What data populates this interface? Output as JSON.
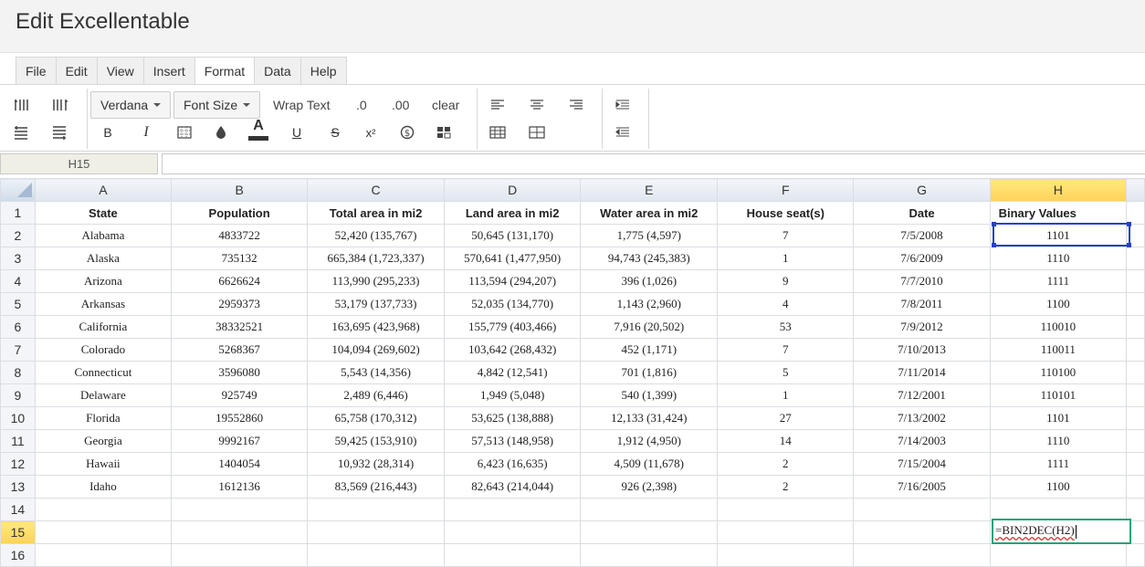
{
  "app": {
    "title": "Edit Excellentable"
  },
  "menu": [
    "File",
    "Edit",
    "View",
    "Insert",
    "Format",
    "Data",
    "Help"
  ],
  "menu_active": "Format",
  "toolbar": {
    "font_family": "Verdana",
    "font_size": "Font Size",
    "wrap_text": "Wrap Text",
    "decrease_decimal": ".0",
    "increase_decimal": ".00",
    "clear": "clear",
    "bold": "B",
    "italic": "I",
    "underline": "U",
    "strikethrough": "S",
    "text_color": "A",
    "superscript": "x²"
  },
  "name_box": "H15",
  "formula_bar": "",
  "columns": [
    "A",
    "B",
    "C",
    "D",
    "E",
    "F",
    "G",
    "H"
  ],
  "selected_column": "H",
  "selected_row": "15",
  "rows": [
    {
      "n": "1",
      "cells": [
        "State",
        "Population",
        "Total area in mi2",
        "Land area in mi2",
        "Water area in mi2",
        "House seat(s)",
        "Date",
        "Binary Values"
      ]
    },
    {
      "n": "2",
      "cells": [
        "Alabama",
        "4833722",
        "52,420 (135,767)",
        "50,645 (131,170)",
        "1,775 (4,597)",
        "7",
        "7/5/2008",
        "1101"
      ]
    },
    {
      "n": "3",
      "cells": [
        "Alaska",
        "735132",
        "665,384 (1,723,337)",
        "570,641 (1,477,950)",
        "94,743 (245,383)",
        "1",
        "7/6/2009",
        "1110"
      ]
    },
    {
      "n": "4",
      "cells": [
        "Arizona",
        "6626624",
        "113,990 (295,233)",
        "113,594 (294,207)",
        "396 (1,026)",
        "9",
        "7/7/2010",
        "1111"
      ]
    },
    {
      "n": "5",
      "cells": [
        "Arkansas",
        "2959373",
        "53,179 (137,733)",
        "52,035 (134,770)",
        "1,143 (2,960)",
        "4",
        "7/8/2011",
        "1100"
      ]
    },
    {
      "n": "6",
      "cells": [
        "California",
        "38332521",
        "163,695 (423,968)",
        "155,779 (403,466)",
        "7,916 (20,502)",
        "53",
        "7/9/2012",
        "110010"
      ]
    },
    {
      "n": "7",
      "cells": [
        "Colorado",
        "5268367",
        "104,094 (269,602)",
        "103,642 (268,432)",
        "452 (1,171)",
        "7",
        "7/10/2013",
        "110011"
      ]
    },
    {
      "n": "8",
      "cells": [
        "Connecticut",
        "3596080",
        "5,543 (14,356)",
        "4,842 (12,541)",
        "701 (1,816)",
        "5",
        "7/11/2014",
        "110100"
      ]
    },
    {
      "n": "9",
      "cells": [
        "Delaware",
        "925749",
        "2,489 (6,446)",
        "1,949 (5,048)",
        "540 (1,399)",
        "1",
        "7/12/2001",
        "110101"
      ]
    },
    {
      "n": "10",
      "cells": [
        "Florida",
        "19552860",
        "65,758 (170,312)",
        "53,625 (138,888)",
        "12,133 (31,424)",
        "27",
        "7/13/2002",
        "1101"
      ]
    },
    {
      "n": "11",
      "cells": [
        "Georgia",
        "9992167",
        "59,425 (153,910)",
        "57,513 (148,958)",
        "1,912 (4,950)",
        "14",
        "7/14/2003",
        "1110"
      ]
    },
    {
      "n": "12",
      "cells": [
        "Hawaii",
        "1404054",
        "10,932 (28,314)",
        "6,423 (16,635)",
        "4,509 (11,678)",
        "2",
        "7/15/2004",
        "1111"
      ]
    },
    {
      "n": "13",
      "cells": [
        "Idaho",
        "1612136",
        "83,569 (216,443)",
        "82,643 (214,044)",
        "926 (2,398)",
        "2",
        "7/16/2005",
        "1100"
      ]
    },
    {
      "n": "14",
      "cells": [
        "",
        "",
        "",
        "",
        "",
        "",
        "",
        ""
      ]
    },
    {
      "n": "15",
      "cells": [
        "",
        "",
        "",
        "",
        "",
        "",
        "",
        ""
      ]
    },
    {
      "n": "16",
      "cells": [
        "",
        "",
        "",
        "",
        "",
        "",
        "",
        ""
      ]
    }
  ],
  "editing_cell": {
    "ref": "H15",
    "value": "=BIN2DEC(H2)"
  },
  "colors": {
    "selection": "#2641c6",
    "edit_border": "#1aa37a",
    "header_selected": "#ffd35a"
  }
}
